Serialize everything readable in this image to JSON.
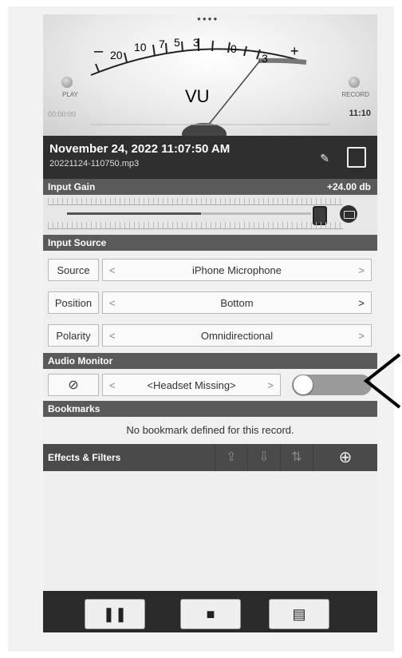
{
  "meter": {
    "scale_labels": [
      "20",
      "10",
      "7",
      "5",
      "3",
      "0",
      "3"
    ],
    "minus": "–",
    "plus": "+",
    "vu_label": "VU",
    "pager_dots": "●●●●",
    "play_label": "PLAY",
    "record_label": "RECORD",
    "time_elapsed": "00:00:00",
    "time_record": "11:10"
  },
  "record": {
    "title": "November 24, 2022 11:07:50 AM",
    "file": "20221124-110750.mp3"
  },
  "input_gain": {
    "label": "Input Gain",
    "value": "+24.00 db",
    "level_fraction": 0.55
  },
  "input_source": {
    "header": "Input Source",
    "rows": [
      {
        "label": "Source",
        "value": "iPhone Microphone"
      },
      {
        "label": "Position",
        "value": "Bottom"
      },
      {
        "label": "Polarity",
        "value": "Omnidirectional"
      }
    ]
  },
  "audio_monitor": {
    "header": "Audio Monitor",
    "icon": "⊘",
    "value": "<Headset Missing>",
    "enabled": false
  },
  "bookmarks": {
    "header": "Bookmarks",
    "empty_text": "No bookmark defined for this record."
  },
  "effects": {
    "label": "Effects & Filters"
  },
  "controls": {
    "pause": "❚❚",
    "stop": "■",
    "notes": "▤"
  },
  "arrows": {
    "lt": "<",
    "gt": ">"
  }
}
